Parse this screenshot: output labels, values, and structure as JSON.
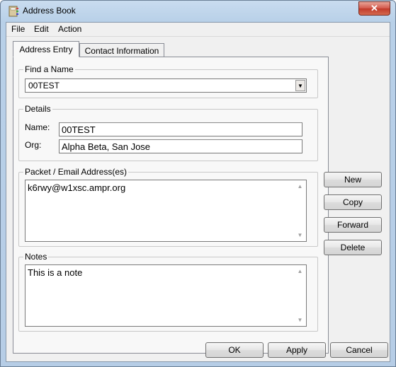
{
  "window": {
    "title": "Address Book",
    "close_label": "✕"
  },
  "menu": [
    "File",
    "Edit",
    "Action"
  ],
  "tabs": [
    {
      "label": "Address Entry"
    },
    {
      "label": "Contact Information"
    }
  ],
  "find_name": {
    "legend": "Find a Name",
    "value": "00TEST"
  },
  "details": {
    "legend": "Details",
    "name_label": "Name:",
    "name_value": "00TEST",
    "org_label": "Org:",
    "org_value": "Alpha Beta, San Jose"
  },
  "packet": {
    "legend": "Packet / Email Address(es)",
    "value": "k6rwy@w1xsc.ampr.org"
  },
  "notes": {
    "legend": "Notes",
    "value": "This is a note"
  },
  "side_buttons": [
    "New",
    "Copy",
    "Forward",
    "Delete"
  ],
  "bottom_buttons": [
    "OK",
    "Apply",
    "Cancel"
  ]
}
